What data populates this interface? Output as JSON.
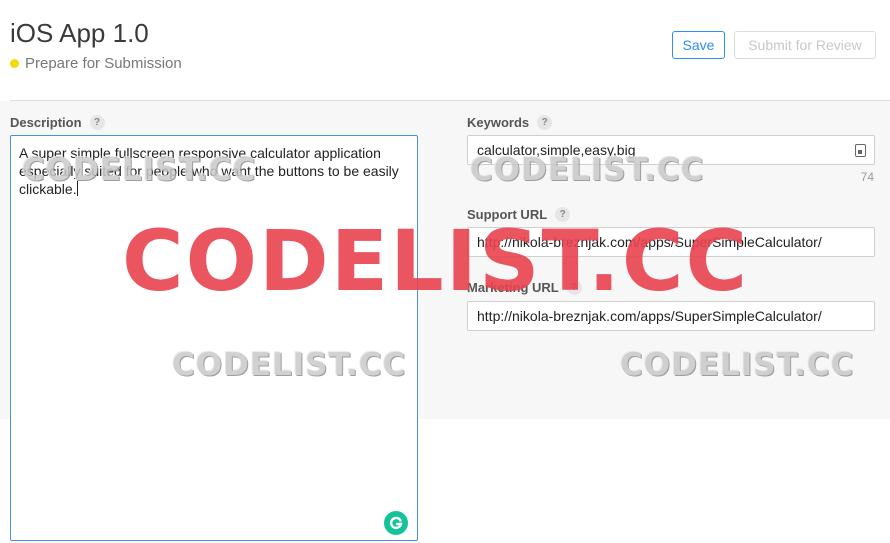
{
  "header": {
    "title": "iOS App 1.0",
    "status": "Prepare for Submission",
    "status_color": "#f5d90a",
    "save_label": "Save",
    "submit_label": "Submit for Review"
  },
  "description": {
    "label": "Description",
    "help": "?",
    "value": "A super simple fullscreen responsive calculator application especially suited for people who want the buttons to be easily clickable."
  },
  "keywords": {
    "label": "Keywords",
    "help": "?",
    "value": "calculator,simple,easy,big",
    "remaining": "74"
  },
  "support_url": {
    "label": "Support URL",
    "help": "?",
    "value": "http://nikola-breznjak.com/apps/SuperSimpleCalculator/"
  },
  "marketing_url": {
    "label": "Marketing URL",
    "help": "?",
    "value": "http://nikola-breznjak.com/apps/SuperSimpleCalculator/"
  },
  "watermark": {
    "text": "CODELIST.CC",
    "color": "#e8434f"
  }
}
